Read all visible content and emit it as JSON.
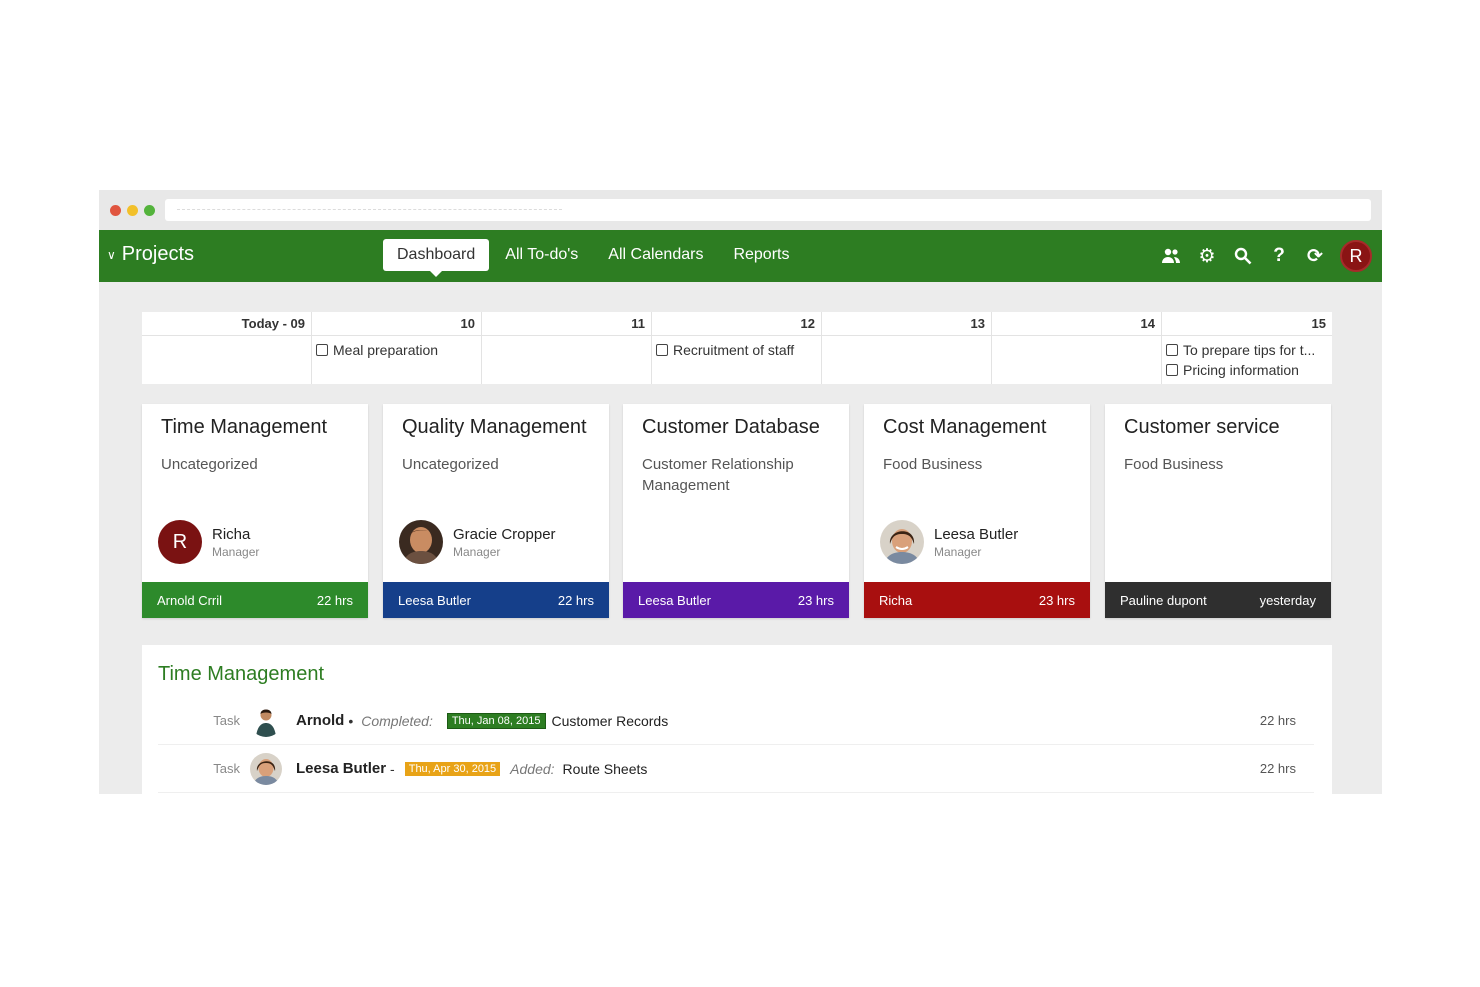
{
  "nav": {
    "project_label": "Projects",
    "tabs": [
      {
        "label": "Dashboard"
      },
      {
        "label": "All To-do's"
      },
      {
        "label": "All Calendars"
      },
      {
        "label": "Reports"
      }
    ],
    "user_initial": "R",
    "icons": [
      "people-icon",
      "gear-icon",
      "search-icon",
      "help-icon",
      "refresh-icon"
    ]
  },
  "calendar": {
    "days": [
      {
        "label": "Today - 09",
        "items": []
      },
      {
        "label": "10",
        "items": [
          "Meal preparation"
        ]
      },
      {
        "label": "11",
        "items": []
      },
      {
        "label": "12",
        "items": [
          "Recruitment of staff"
        ]
      },
      {
        "label": "13",
        "items": []
      },
      {
        "label": "14",
        "items": []
      },
      {
        "label": "15",
        "items": [
          "To prepare tips for t...",
          "Pricing information"
        ]
      }
    ]
  },
  "cards": [
    {
      "title": "Time Management",
      "subtitle": "Uncategorized",
      "person": "Richa",
      "role": "Manager",
      "initial": "R",
      "footer_name": "Arnold Crril",
      "footer_value": "22 hrs",
      "color": "#2d8a2b"
    },
    {
      "title": "Quality Management",
      "subtitle": "Uncategorized",
      "person": "Gracie Cropper",
      "role": "Manager",
      "initial": "",
      "footer_name": "Leesa Butler",
      "footer_value": "22 hrs",
      "color": "#153f8a"
    },
    {
      "title": "Customer Database",
      "subtitle": "Customer Relationship Management",
      "person": "",
      "role": "",
      "initial": "",
      "footer_name": "Leesa Butler",
      "footer_value": "23 hrs",
      "color": "#5a1aa8"
    },
    {
      "title": "Cost Management",
      "subtitle": "Food Business",
      "person": "Leesa Butler",
      "role": "Manager",
      "initial": "",
      "footer_name": "Richa",
      "footer_value": "23 hrs",
      "color": "#a80f0f"
    },
    {
      "title": "Customer service",
      "subtitle": "Food Business",
      "person": "",
      "role": "",
      "initial": "",
      "footer_name": "Pauline dupont",
      "footer_value": "yesterday",
      "color": "#2f2f2f"
    }
  ],
  "activity": {
    "title": "Time Management",
    "rows": [
      {
        "type": "Task",
        "who": "Arnold",
        "verb": "Completed:",
        "date": "Thu, Jan 08, 2015",
        "object": "Customer Records",
        "hours": "22 hrs"
      },
      {
        "type": "Task",
        "who": "Leesa Butler",
        "date": "Thu, Apr 30, 2015",
        "verb": "Added:",
        "object": "Route Sheets",
        "hours": "22 hrs"
      }
    ]
  }
}
